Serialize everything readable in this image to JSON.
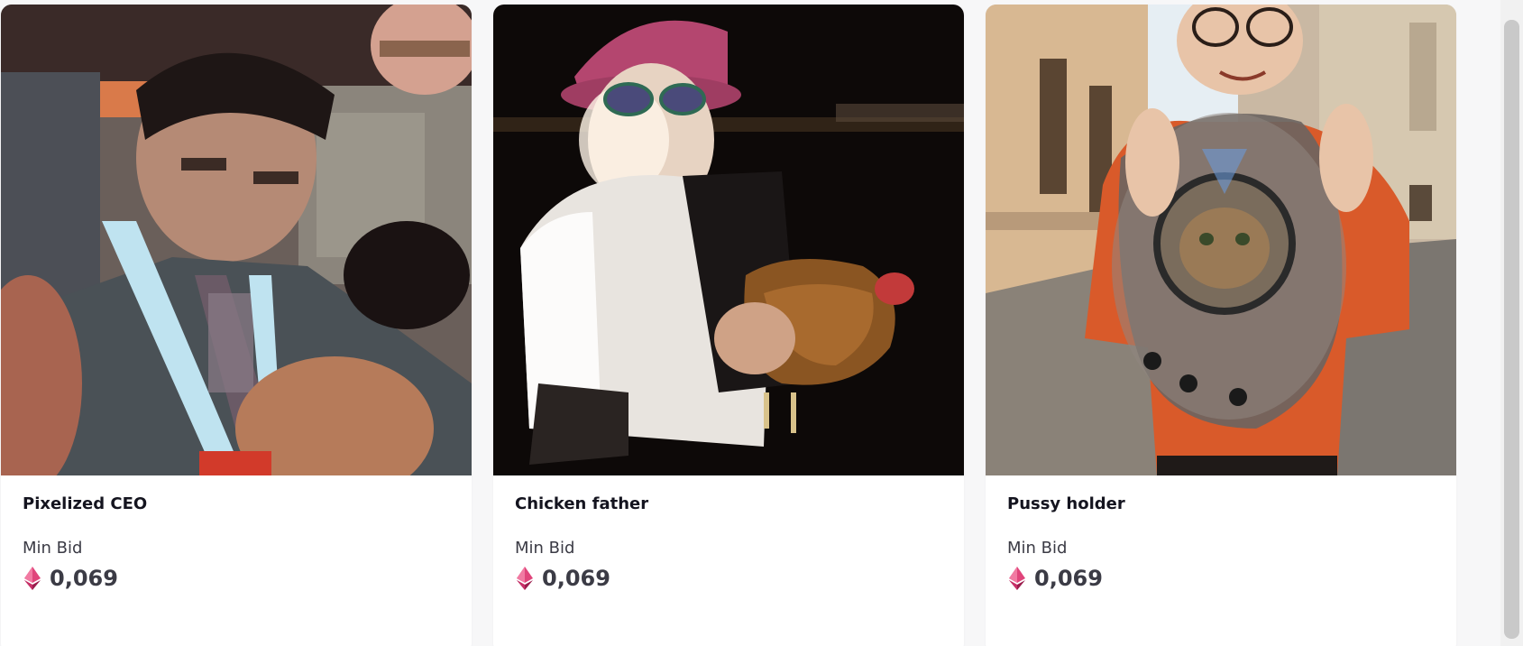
{
  "cards": [
    {
      "title": "Pixelized CEO",
      "min_bid_label": "Min Bid",
      "price": "0,069",
      "image_alt": "photo-pixelized-man-with-lanyard"
    },
    {
      "title": "Chicken father",
      "min_bid_label": "Min Bid",
      "price": "0,069",
      "image_alt": "photo-man-holding-chicken"
    },
    {
      "title": "Pussy holder",
      "min_bid_label": "Min Bid",
      "price": "0,069",
      "image_alt": "photo-man-with-cat-backpack"
    }
  ],
  "colors": {
    "eth_icon_primary": "#e0457b",
    "eth_icon_dark": "#9b1d4d",
    "title_text": "#14141f",
    "body_text": "#3b3b45"
  },
  "icons": {
    "currency": "ethereum-icon"
  }
}
